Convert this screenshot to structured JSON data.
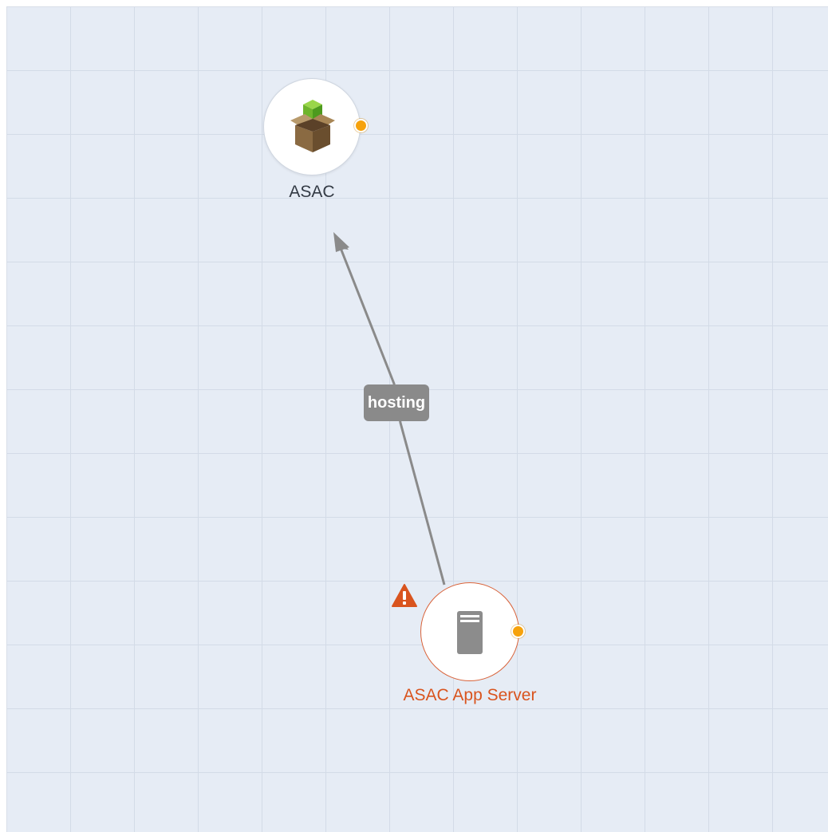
{
  "nodes": {
    "asac": {
      "label": "ASAC",
      "icon": "package-box-icon",
      "status_color": "#f6a20c"
    },
    "app_server": {
      "label": "ASAC App Server",
      "icon": "server-icon",
      "status_color": "#f6a20c",
      "warning_icon": "warning-triangle-icon"
    }
  },
  "edges": [
    {
      "from": "ASAC App Server",
      "to": "ASAC",
      "label": "hosting"
    }
  ],
  "colors": {
    "canvas_background": "#e6ecf5",
    "grid_line": "#d3dbe7",
    "edge": "#8a8a8a",
    "warning": "#d9541e"
  }
}
